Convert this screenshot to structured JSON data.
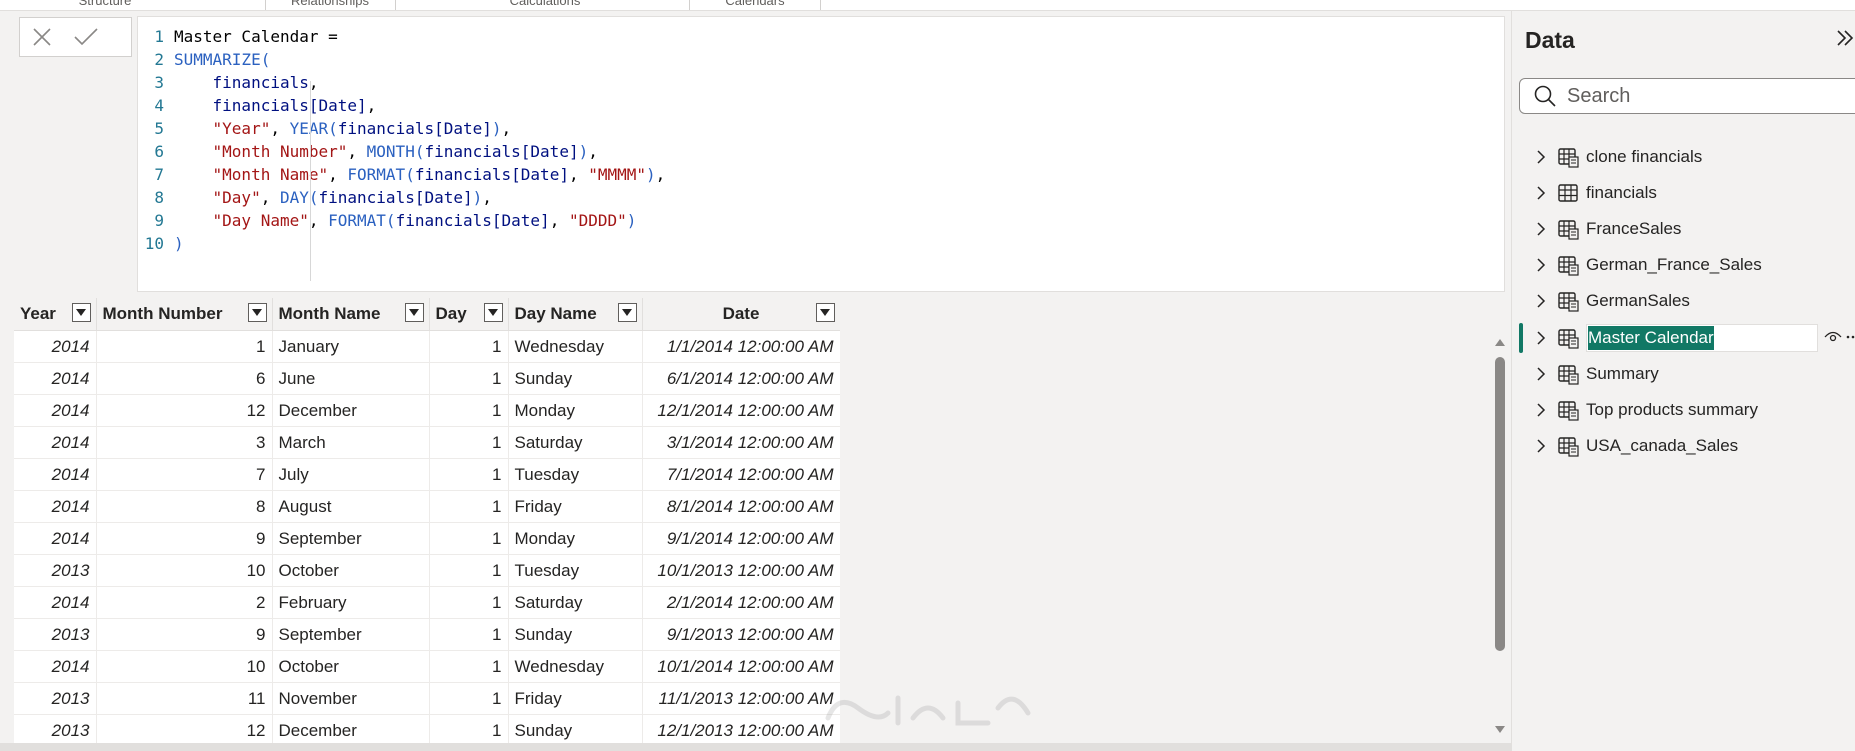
{
  "ribbon": {
    "groups": [
      "Structure",
      "Relationships",
      "Calculations",
      "Calendars"
    ]
  },
  "editor": {
    "lines": [
      {
        "n": "1",
        "tokens": [
          {
            "t": "Master Calendar =",
            "c": "plain"
          }
        ]
      },
      {
        "n": "2",
        "tokens": [
          {
            "t": "SUMMARIZE(",
            "c": "fn"
          }
        ]
      },
      {
        "n": "3",
        "tokens": [
          {
            "t": "    ",
            "c": "plain"
          },
          {
            "t": "financials",
            "c": "id"
          },
          {
            "t": ",",
            "c": "plain"
          }
        ]
      },
      {
        "n": "4",
        "tokens": [
          {
            "t": "    ",
            "c": "plain"
          },
          {
            "t": "financials[Date]",
            "c": "id"
          },
          {
            "t": ",",
            "c": "plain"
          }
        ]
      },
      {
        "n": "5",
        "tokens": [
          {
            "t": "    ",
            "c": "plain"
          },
          {
            "t": "\"Year\"",
            "c": "str"
          },
          {
            "t": ", ",
            "c": "plain"
          },
          {
            "t": "YEAR(",
            "c": "fn"
          },
          {
            "t": "financials[Date]",
            "c": "id"
          },
          {
            "t": ")",
            "c": "fn"
          },
          {
            "t": ",",
            "c": "plain"
          }
        ]
      },
      {
        "n": "6",
        "tokens": [
          {
            "t": "    ",
            "c": "plain"
          },
          {
            "t": "\"Month Number\"",
            "c": "str"
          },
          {
            "t": ", ",
            "c": "plain"
          },
          {
            "t": "MONTH(",
            "c": "fn"
          },
          {
            "t": "financials[Date]",
            "c": "id"
          },
          {
            "t": ")",
            "c": "fn"
          },
          {
            "t": ",",
            "c": "plain"
          }
        ]
      },
      {
        "n": "7",
        "tokens": [
          {
            "t": "    ",
            "c": "plain"
          },
          {
            "t": "\"Month Name\"",
            "c": "str"
          },
          {
            "t": ", ",
            "c": "plain"
          },
          {
            "t": "FORMAT(",
            "c": "fn"
          },
          {
            "t": "financials[Date]",
            "c": "id"
          },
          {
            "t": ", ",
            "c": "plain"
          },
          {
            "t": "\"MMMM\"",
            "c": "str"
          },
          {
            "t": ")",
            "c": "fn"
          },
          {
            "t": ",",
            "c": "plain"
          }
        ]
      },
      {
        "n": "8",
        "tokens": [
          {
            "t": "    ",
            "c": "plain"
          },
          {
            "t": "\"Day\"",
            "c": "str"
          },
          {
            "t": ", ",
            "c": "plain"
          },
          {
            "t": "DAY(",
            "c": "fn"
          },
          {
            "t": "financials[Date]",
            "c": "id"
          },
          {
            "t": ")",
            "c": "fn"
          },
          {
            "t": ",",
            "c": "plain"
          }
        ]
      },
      {
        "n": "9",
        "tokens": [
          {
            "t": "    ",
            "c": "plain"
          },
          {
            "t": "\"Day Name\"",
            "c": "str"
          },
          {
            "t": ", ",
            "c": "plain"
          },
          {
            "t": "FORMAT(",
            "c": "fn"
          },
          {
            "t": "financials[Date]",
            "c": "id"
          },
          {
            "t": ", ",
            "c": "plain"
          },
          {
            "t": "\"DDDD\"",
            "c": "str"
          },
          {
            "t": ")",
            "c": "fn"
          }
        ]
      },
      {
        "n": "10",
        "tokens": [
          {
            "t": ")",
            "c": "fn"
          }
        ]
      }
    ]
  },
  "grid": {
    "columns": [
      "Year",
      "Month Number",
      "Month Name",
      "Day",
      "Day Name",
      "Date"
    ],
    "rows": [
      [
        "2014",
        "1",
        "January",
        "1",
        "Wednesday",
        "1/1/2014 12:00:00 AM"
      ],
      [
        "2014",
        "6",
        "June",
        "1",
        "Sunday",
        "6/1/2014 12:00:00 AM"
      ],
      [
        "2014",
        "12",
        "December",
        "1",
        "Monday",
        "12/1/2014 12:00:00 AM"
      ],
      [
        "2014",
        "3",
        "March",
        "1",
        "Saturday",
        "3/1/2014 12:00:00 AM"
      ],
      [
        "2014",
        "7",
        "July",
        "1",
        "Tuesday",
        "7/1/2014 12:00:00 AM"
      ],
      [
        "2014",
        "8",
        "August",
        "1",
        "Friday",
        "8/1/2014 12:00:00 AM"
      ],
      [
        "2014",
        "9",
        "September",
        "1",
        "Monday",
        "9/1/2014 12:00:00 AM"
      ],
      [
        "2013",
        "10",
        "October",
        "1",
        "Tuesday",
        "10/1/2013 12:00:00 AM"
      ],
      [
        "2014",
        "2",
        "February",
        "1",
        "Saturday",
        "2/1/2014 12:00:00 AM"
      ],
      [
        "2013",
        "9",
        "September",
        "1",
        "Sunday",
        "9/1/2013 12:00:00 AM"
      ],
      [
        "2014",
        "10",
        "October",
        "1",
        "Wednesday",
        "10/1/2014 12:00:00 AM"
      ],
      [
        "2013",
        "11",
        "November",
        "1",
        "Friday",
        "11/1/2013 12:00:00 AM"
      ],
      [
        "2013",
        "12",
        "December",
        "1",
        "Sunday",
        "12/1/2013 12:00:00 AM"
      ]
    ]
  },
  "data_pane": {
    "title": "Data",
    "search_placeholder": "Search",
    "tables": [
      {
        "name": "clone financials",
        "icon": "calculated-table-icon"
      },
      {
        "name": "financials",
        "icon": "table-icon"
      },
      {
        "name": "FranceSales",
        "icon": "calculated-table-icon"
      },
      {
        "name": "German_France_Sales",
        "icon": "calculated-table-icon"
      },
      {
        "name": "GermanSales",
        "icon": "calculated-table-icon"
      },
      {
        "name": "Master Calendar",
        "icon": "calculated-table-icon",
        "selected": true,
        "editing": true
      },
      {
        "name": "Summary",
        "icon": "calculated-table-icon"
      },
      {
        "name": "Top products summary",
        "icon": "calculated-table-icon"
      },
      {
        "name": "USA_canada_Sales",
        "icon": "calculated-table-icon"
      }
    ]
  },
  "colors": {
    "accent": "#117865",
    "fn": "#2b61c0",
    "string": "#a31515",
    "identifier": "#001080"
  }
}
